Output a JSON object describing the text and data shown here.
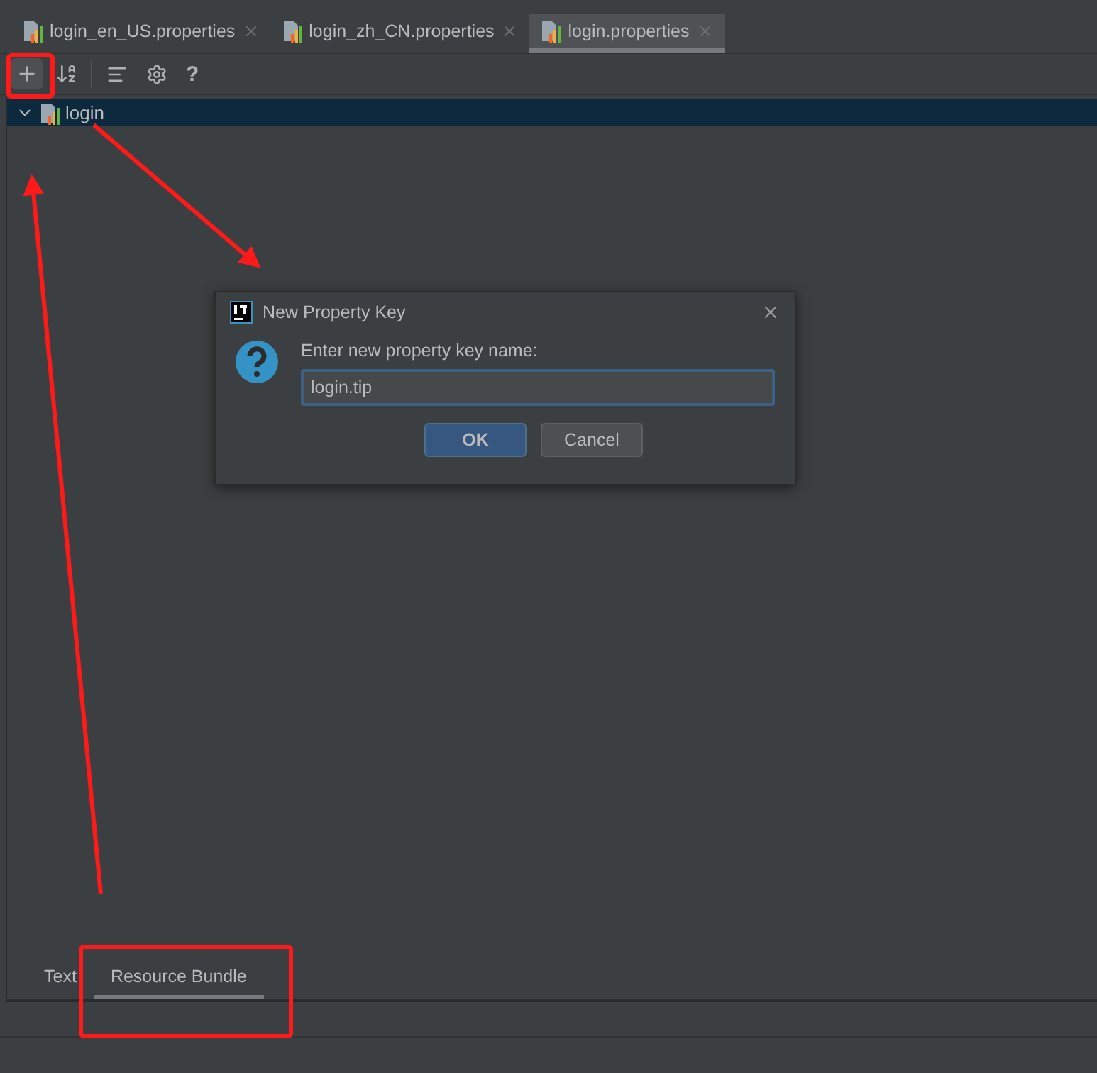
{
  "tabs": [
    {
      "label": "login_en_US.properties",
      "selected": false
    },
    {
      "label": "login_zh_CN.properties",
      "selected": false
    },
    {
      "label": "login.properties",
      "selected": true
    }
  ],
  "toolbar": {
    "help": "?"
  },
  "tree": [
    {
      "label": "login",
      "expanded": true,
      "selected": true
    }
  ],
  "dialog": {
    "title": "New Property Key",
    "prompt": "Enter new property key name:",
    "value": "login.tip",
    "buttons": [
      {
        "label": "OK",
        "kind": "primary"
      },
      {
        "label": "Cancel",
        "kind": "secondary"
      }
    ]
  },
  "bottom_tabs": [
    {
      "label": "Text",
      "selected": false
    },
    {
      "label": "Resource Bundle",
      "selected": true
    }
  ]
}
